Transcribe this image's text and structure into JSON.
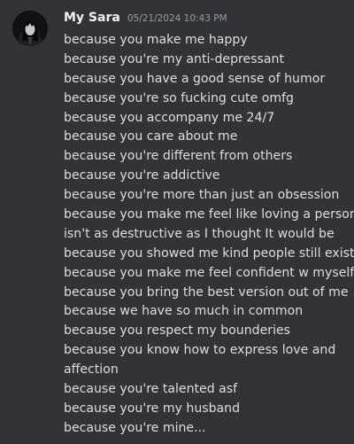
{
  "message": {
    "username": "My Sara",
    "timestamp": "05/21/2024 10:43 PM",
    "lines": [
      "because you make me happy",
      "because you're my anti-depressant",
      "because you have a good sense of humor",
      "because you're so fucking cute omfg",
      "because you accompany me 24/7",
      "because you care about me",
      "because you're different from others",
      "because you're addictive",
      "because you're more than just an obsession",
      "because you make me feel like loving a person",
      "isn't as destructive as I thought It would be",
      "because you showed me kind people still exist",
      "because you make me feel confident w myself",
      "because you bring the best version out of me",
      "because we have so much in common",
      "because you respect my bounderies",
      "because you know how to express love and",
      "affection",
      "because you're talented asf",
      "because you're my husband",
      "because you're mine..."
    ]
  },
  "colors": {
    "background": "#313338",
    "username": "#f2f3f5",
    "timestamp": "#949ba4",
    "text": "#dbdee1"
  },
  "icons": {
    "avatar": "user-avatar-picture"
  }
}
